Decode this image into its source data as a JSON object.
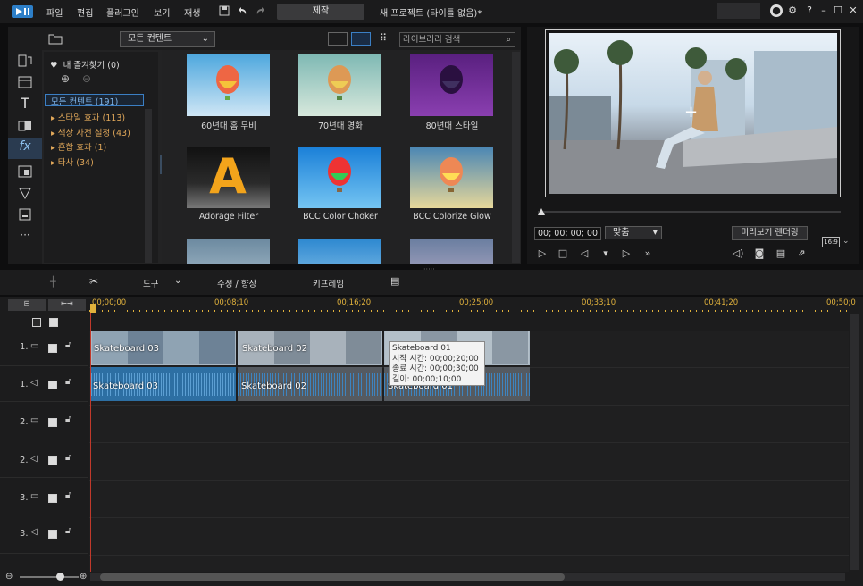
{
  "app": {
    "title": "새 프로젝트 (타이틀 없음)*",
    "menus": [
      "파일",
      "편집",
      "플러그인",
      "보기",
      "재생"
    ],
    "produce_label": "제작"
  },
  "library": {
    "content_filter": "모든 컨텐트",
    "search_placeholder": "라이브러리 검색",
    "favorites": "내 즐겨찾기 (0)",
    "all_content": "모든 컨텐트 (191)",
    "categories": [
      "스타일 효과  (113)",
      "색상 사전 설정  (43)",
      "혼합 효과  (1)",
      "타사  (34)"
    ],
    "thumbnails": [
      "60년대 홈 무비",
      "70년대 영화",
      "80년대 스타일",
      "Adorage Filter",
      "BCC Color Choker",
      "BCC Colorize Glow"
    ]
  },
  "preview": {
    "timecode": "00; 00; 00; 00",
    "fit": "맞춤",
    "render_label": "미리보기 렌더링",
    "ratio": "16:9"
  },
  "toolbar": {
    "tools": "도구",
    "edit": "수정 / 향상",
    "keyframe": "키프레임"
  },
  "timeline": {
    "ruler": [
      "00;00;00",
      "00;08;10",
      "00;16;20",
      "00;25;00",
      "00;33;10",
      "00;41;20",
      "00;50;0"
    ],
    "tracks": [
      "1.",
      "1.",
      "2.",
      "2.",
      "3.",
      "3."
    ],
    "clips": [
      "Skateboard 03",
      "Skateboard 02",
      "Skateboard 01"
    ],
    "audio_clips": [
      "Skateboard 03",
      "Skateboard 02",
      "Skateboard 01"
    ],
    "tooltip": {
      "name": "Skateboard 01",
      "start": "시작 시간: 00;00;20;00",
      "end": "종료 시간: 00;00;30;00",
      "length": "길이: 00;00;10;00"
    }
  },
  "colors": {
    "accent": "#3b7fc4",
    "ruler": "#e0b13c",
    "audio": "#2d6fa3",
    "playhead": "#c0392b"
  }
}
